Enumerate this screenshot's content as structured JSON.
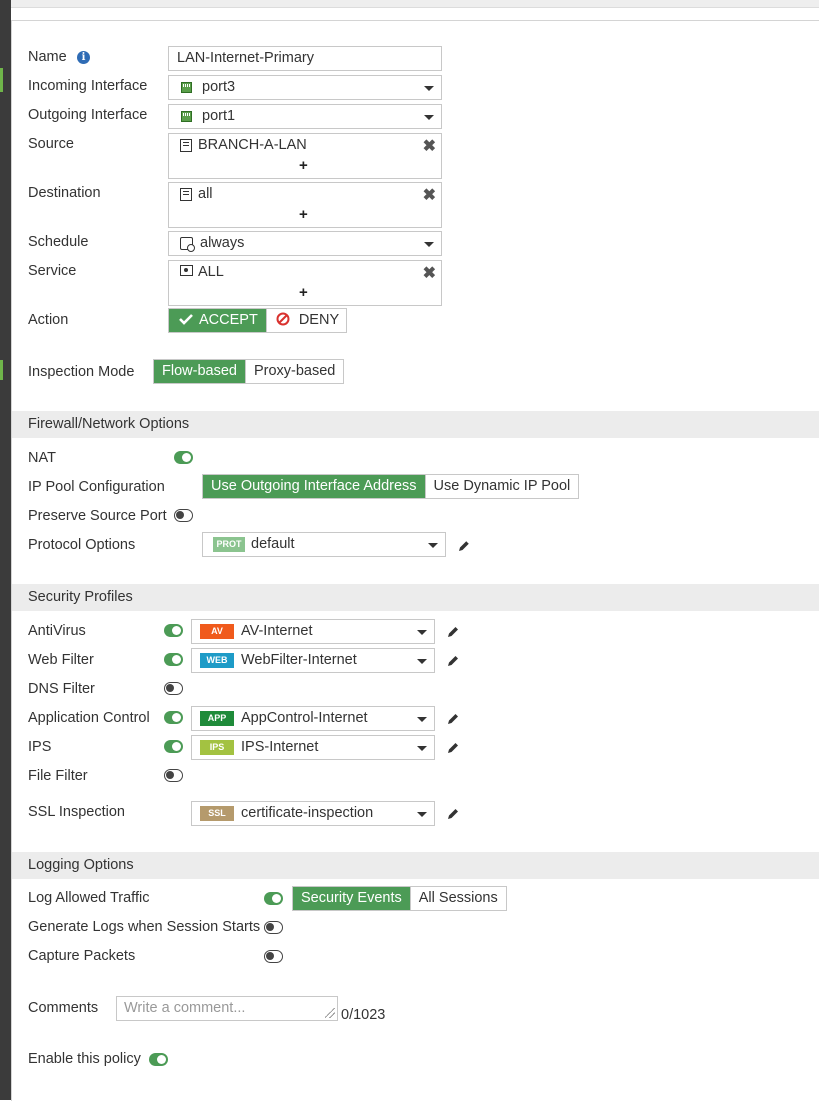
{
  "colors": {
    "accent_green": "#4c9b56",
    "av_badge": "#f05a1c",
    "web_badge": "#1e9bc7",
    "app_badge": "#1f8b3a",
    "ips_badge": "#a3c241",
    "ssl_badge": "#b59a6c",
    "prot_badge": "#8bc48f",
    "deny_icon": "#d9322e",
    "info_icon": "#2f6cb5"
  },
  "policy": {
    "name_label": "Name",
    "name_value": "LAN-Internet-Primary",
    "incoming_label": "Incoming Interface",
    "incoming_value": "port3",
    "outgoing_label": "Outgoing Interface",
    "outgoing_value": "port1",
    "source_label": "Source",
    "source_value": "BRANCH-A-LAN",
    "destination_label": "Destination",
    "destination_value": "all",
    "schedule_label": "Schedule",
    "schedule_value": "always",
    "service_label": "Service",
    "service_value": "ALL",
    "add_symbol": "+",
    "remove_symbol": "✖",
    "action_label": "Action",
    "action_accept": "ACCEPT",
    "action_deny": "DENY",
    "action_selected": "ACCEPT",
    "inspection_label": "Inspection Mode",
    "inspection_flow": "Flow-based",
    "inspection_proxy": "Proxy-based",
    "inspection_selected": "Flow-based"
  },
  "firewall": {
    "section_title": "Firewall/Network Options",
    "nat_label": "NAT",
    "nat_enabled": true,
    "ippool_label": "IP Pool Configuration",
    "ippool_outgoing": "Use Outgoing Interface Address",
    "ippool_dynamic": "Use Dynamic IP Pool",
    "ippool_selected": "Use Outgoing Interface Address",
    "preserve_label": "Preserve Source Port",
    "preserve_enabled": false,
    "protocol_label": "Protocol Options",
    "protocol_badge": "PROT",
    "protocol_value": "default"
  },
  "security": {
    "section_title": "Security Profiles",
    "antivirus": {
      "label": "AntiVirus",
      "enabled": true,
      "badge": "AV",
      "value": "AV-Internet"
    },
    "webfilter": {
      "label": "Web Filter",
      "enabled": true,
      "badge": "WEB",
      "value": "WebFilter-Internet"
    },
    "dnsfilter": {
      "label": "DNS Filter",
      "enabled": false
    },
    "appcontrol": {
      "label": "Application Control",
      "enabled": true,
      "badge": "APP",
      "value": "AppControl-Internet"
    },
    "ips": {
      "label": "IPS",
      "enabled": true,
      "badge": "IPS",
      "value": "IPS-Internet"
    },
    "filefilter": {
      "label": "File Filter",
      "enabled": false
    },
    "ssl": {
      "label": "SSL Inspection",
      "badge": "SSL",
      "value": "certificate-inspection"
    }
  },
  "logging": {
    "section_title": "Logging Options",
    "allowed_label": "Log Allowed Traffic",
    "allowed_enabled": true,
    "opt_security": "Security Events",
    "opt_all": "All Sessions",
    "selected": "Security Events",
    "session_start_label": "Generate Logs when Session Starts",
    "session_start_enabled": false,
    "capture_label": "Capture Packets",
    "capture_enabled": false
  },
  "comments": {
    "label": "Comments",
    "placeholder": "Write a comment...",
    "counter": "0/1023"
  },
  "enable": {
    "label": "Enable this policy",
    "enabled": true
  }
}
